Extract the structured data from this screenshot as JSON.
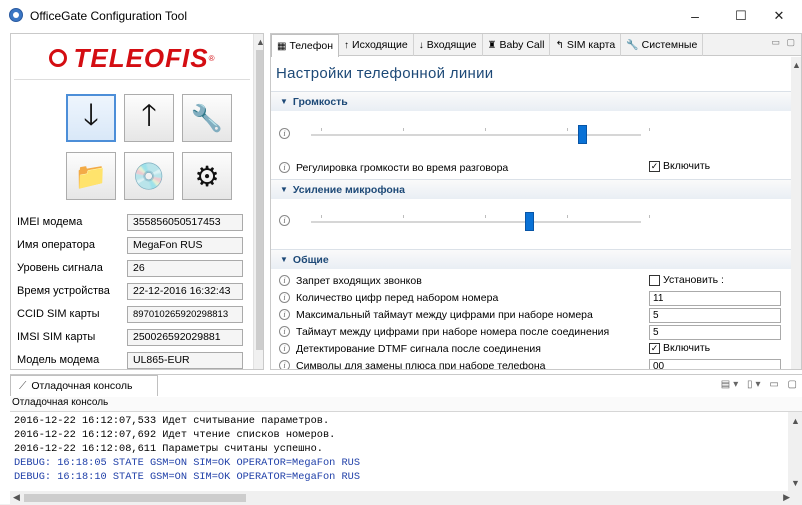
{
  "window": {
    "title": "OfficeGate Configuration Tool",
    "controls": {
      "minimize": "–",
      "maximize": "☐",
      "close": "✕"
    }
  },
  "logo": {
    "text": "TELEOFIS",
    "reg": "®",
    "color": "#d40d12"
  },
  "toolbar_buttons": [
    {
      "name": "download-button",
      "icon": "download-arrow-icon",
      "glyph": "🡓"
    },
    {
      "name": "upload-button",
      "icon": "upload-arrow-icon",
      "glyph": "🡑"
    },
    {
      "name": "wrench-button",
      "icon": "wrench-icon",
      "glyph": "🔧"
    },
    {
      "name": "folder-button",
      "icon": "folder-icon",
      "glyph": "📁"
    },
    {
      "name": "disc-button",
      "icon": "disc-icon",
      "glyph": "💿"
    },
    {
      "name": "settings-button",
      "icon": "gears-icon",
      "glyph": "⚙"
    }
  ],
  "device_info": [
    {
      "label": "IMEI модема",
      "value": "355856050517453"
    },
    {
      "label": "Имя оператора",
      "value": "MegaFon RUS"
    },
    {
      "label": "Уровень сигнала",
      "value": "26"
    },
    {
      "label": "Время устройства",
      "value": "22-12-2016 16:32:43"
    },
    {
      "label": "CCID SIM карты",
      "value": "89701026592029881​3"
    },
    {
      "label": "IMSI SIM карты",
      "value": "250026592029881"
    },
    {
      "label": "Модель модема",
      "value": "UL865-EUR"
    }
  ],
  "tabs": [
    {
      "label": "Телефон",
      "icon": "▦",
      "active": true
    },
    {
      "label": "Исходящие",
      "icon": "↑",
      "active": false
    },
    {
      "label": "Входящие",
      "icon": "↓",
      "active": false
    },
    {
      "label": "Baby Call",
      "icon": "♜",
      "active": false
    },
    {
      "label": "SIM карта",
      "icon": "↰",
      "active": false
    },
    {
      "label": "Системные",
      "icon": "🔧",
      "active": false
    }
  ],
  "page_title": "Настройки телефонной линии",
  "sections": {
    "volume": {
      "title": "Громкость",
      "slider_level": 0.82,
      "toggle_label": "Регулировка громкости во время разговора",
      "toggle_checkbox": "Включить",
      "toggle_checked": true
    },
    "mic": {
      "title": "Усиление микрофона",
      "slider_level": 0.66
    },
    "general": {
      "title": "Общие",
      "rows": [
        {
          "label": "Запрет входящих звонков",
          "type": "checkbox",
          "value": "Установить :",
          "checked": false
        },
        {
          "label": "Количество цифр перед набором номера",
          "type": "input",
          "value": "11"
        },
        {
          "label": "Максимальный таймаут между цифрами при наборе номера",
          "type": "input",
          "value": "5"
        },
        {
          "label": "Таймаут между цифрами при наборе номера после соединения",
          "type": "input",
          "value": "5"
        },
        {
          "label": "Детектирование DTMF сигнала после соединения",
          "type": "checkbox",
          "value": "Включить",
          "checked": true
        },
        {
          "label": "Символы для замены плюса при наборе телефона",
          "type": "input",
          "value": "00"
        }
      ]
    }
  },
  "console": {
    "tab_label": "Отладочная консоль",
    "label": "Отладочная консоль",
    "lines": [
      {
        "text": "2016-12-22 16:12:07,533 Идет считывание параметров.",
        "debug": false
      },
      {
        "text": "2016-12-22 16:12:07,692 Идет чтение списков номеров.",
        "debug": false
      },
      {
        "text": "2016-12-22 16:12:08,611 Параметры считаны успешно.",
        "debug": false
      },
      {
        "text": "DEBUG: 16:18:05 STATE GSM=ON SIM=OK OPERATOR=MegaFon RUS",
        "debug": true
      },
      {
        "text": "DEBUG: 16:18:10 STATE GSM=ON SIM=OK OPERATOR=MegaFon RUS",
        "debug": true
      }
    ]
  },
  "colors": {
    "accent": "#1d4977",
    "slider": "#0a72d6",
    "debug_text": "#1f3fa8"
  }
}
